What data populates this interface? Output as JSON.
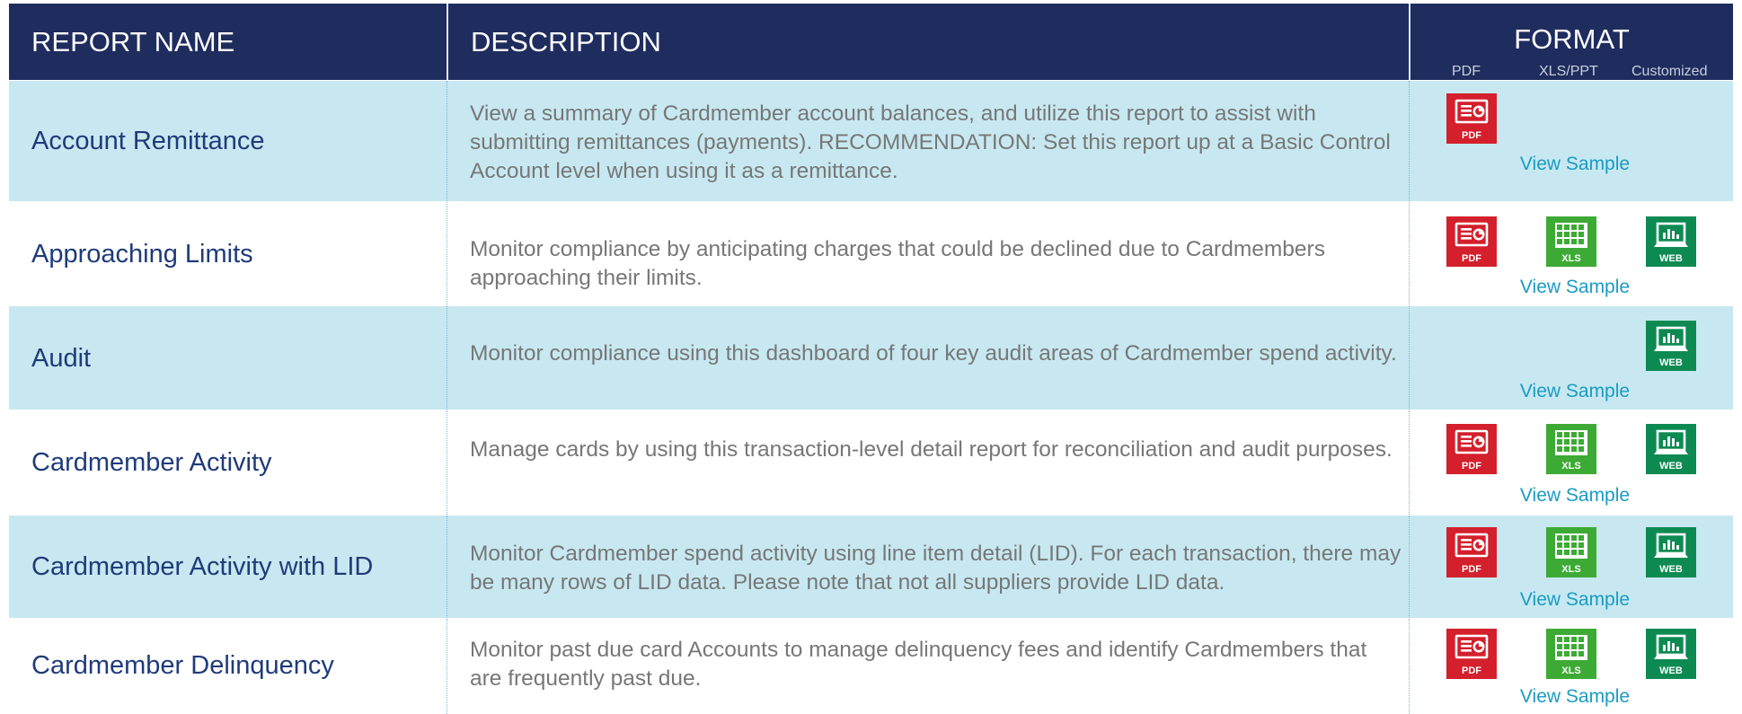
{
  "header": {
    "report_name": "REPORT NAME",
    "description": "DESCRIPTION",
    "format": "FORMAT",
    "format_columns": [
      "PDF",
      "XLS/PPT",
      "Customized"
    ]
  },
  "icons": {
    "pdf_label": "PDF",
    "xls_label": "XLS",
    "web_label": "WEB"
  },
  "colors": {
    "header_bg": "#1f2c5e",
    "row_alt_bg": "#c7e8f0",
    "name_text": "#1f3b7a",
    "desc_text": "#777777",
    "link": "#1a9bc4",
    "pdf_red": "#d3202c",
    "xls_green": "#3daa35",
    "web_green": "#0d8a52"
  },
  "rows": [
    {
      "name": "Account Remittance",
      "description": "View a summary of Cardmember account balances, and utilize this report to assist with submitting remittances (payments). RECOMMENDATION: Set this report up at a Basic Control Account level when using it as a remittance.",
      "formats": [
        "pdf"
      ],
      "link": "View Sample"
    },
    {
      "name": "Approaching Limits",
      "description": "Monitor compliance by anticipating charges that could be declined due to Cardmembers approaching their limits.",
      "formats": [
        "pdf",
        "xls",
        "web"
      ],
      "link": "View Sample"
    },
    {
      "name": "Audit",
      "description": "Monitor compliance using this dashboard of four key audit areas of Cardmember spend activity.",
      "formats": [
        "web"
      ],
      "link": "View Sample"
    },
    {
      "name": "Cardmember Activity",
      "description": "Manage cards by using this transaction-level detail report for reconciliation and audit purposes.",
      "formats": [
        "pdf",
        "xls",
        "web"
      ],
      "link": "View Sample"
    },
    {
      "name": "Cardmember Activity with LID",
      "description": "Monitor Cardmember spend activity using line item detail (LID). For each transaction, there may be many rows of LID data. Please note that not all suppliers provide LID data.",
      "formats": [
        "pdf",
        "xls",
        "web"
      ],
      "link": "View Sample"
    },
    {
      "name": "Cardmember Delinquency",
      "description": "Monitor past due card Accounts to manage delinquency fees and identify Cardmembers that are frequently past due.",
      "formats": [
        "pdf",
        "xls",
        "web"
      ],
      "link": "View Sample"
    }
  ]
}
